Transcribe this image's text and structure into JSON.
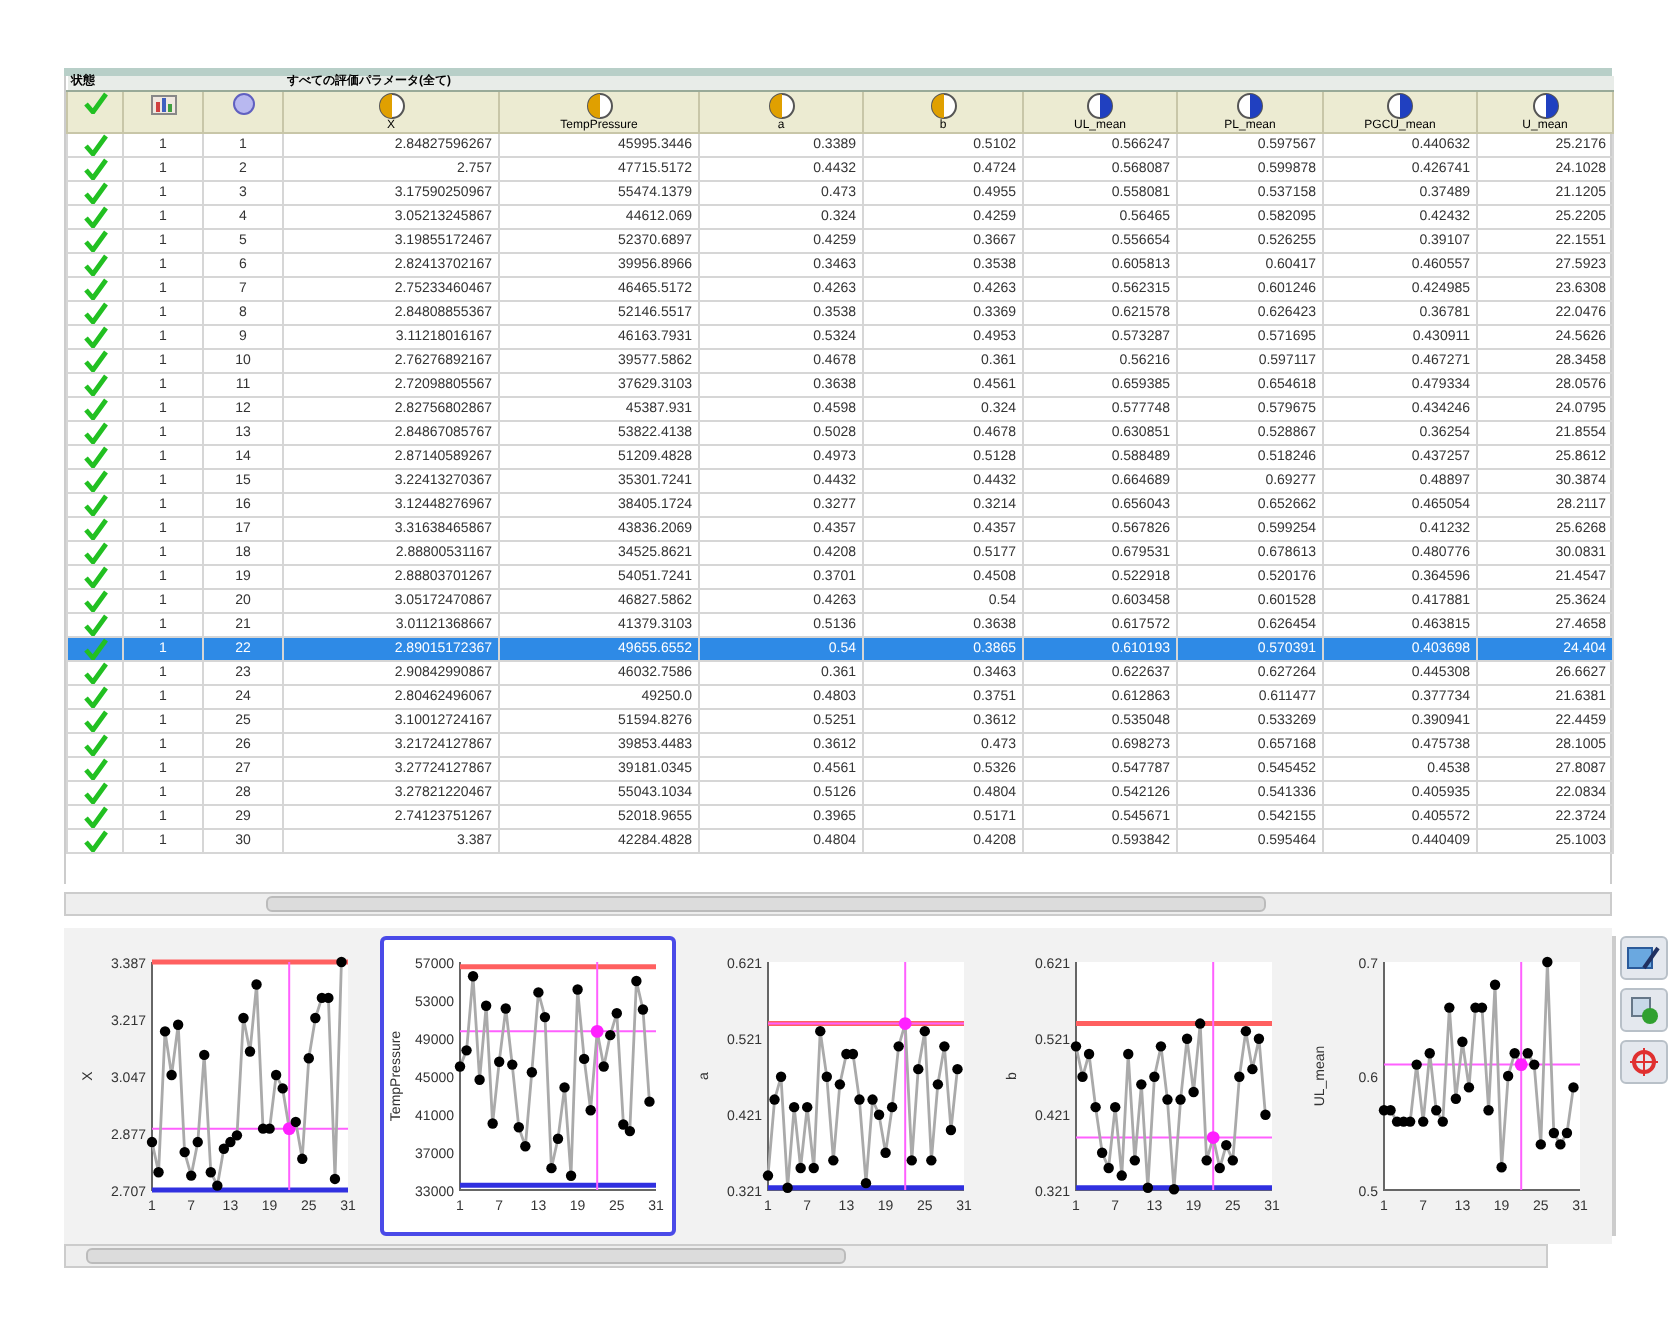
{
  "table": {
    "group_headers": [
      {
        "label": "状態"
      },
      {
        "label": "すべての評価パラメータ(全て)"
      }
    ],
    "columns": [
      {
        "kind": "status"
      },
      {
        "kind": "id"
      },
      {
        "kind": "input",
        "label": "X"
      },
      {
        "kind": "input",
        "label": "TempPressure"
      },
      {
        "kind": "input",
        "label": "a"
      },
      {
        "kind": "input",
        "label": "b"
      },
      {
        "kind": "output",
        "label": "UL_mean"
      },
      {
        "kind": "output",
        "label": "PL_mean"
      },
      {
        "kind": "output",
        "label": "PGCU_mean"
      },
      {
        "kind": "output",
        "label": "U_mean"
      }
    ],
    "rows": [
      {
        "checked": true,
        "selected": false,
        "cells": [
          "1",
          "1",
          "2.84827596267",
          "45995.3446",
          "0.3389",
          "0.5102",
          "0.566247",
          "0.597567",
          "0.440632",
          "25.2176"
        ]
      },
      {
        "checked": true,
        "selected": false,
        "cells": [
          "1",
          "2",
          "2.757",
          "47715.5172",
          "0.4432",
          "0.4724",
          "0.568087",
          "0.599878",
          "0.426741",
          "24.1028"
        ]
      },
      {
        "checked": true,
        "selected": false,
        "cells": [
          "1",
          "3",
          "3.17590250967",
          "55474.1379",
          "0.473",
          "0.4955",
          "0.558081",
          "0.537158",
          "0.37489",
          "21.1205"
        ]
      },
      {
        "checked": true,
        "selected": false,
        "cells": [
          "1",
          "4",
          "3.05213245867",
          "44612.069",
          "0.324",
          "0.4259",
          "0.56465",
          "0.582095",
          "0.42432",
          "25.2205"
        ]
      },
      {
        "checked": true,
        "selected": false,
        "cells": [
          "1",
          "5",
          "3.19855172467",
          "52370.6897",
          "0.4259",
          "0.3667",
          "0.556654",
          "0.526255",
          "0.39107",
          "22.1551"
        ]
      },
      {
        "checked": true,
        "selected": false,
        "cells": [
          "1",
          "6",
          "2.82413702167",
          "39956.8966",
          "0.3463",
          "0.3538",
          "0.605813",
          "0.60417",
          "0.460557",
          "27.5923"
        ]
      },
      {
        "checked": true,
        "selected": false,
        "cells": [
          "1",
          "7",
          "2.75233460467",
          "46465.5172",
          "0.4263",
          "0.4263",
          "0.562315",
          "0.601246",
          "0.424985",
          "23.6308"
        ]
      },
      {
        "checked": true,
        "selected": false,
        "cells": [
          "1",
          "8",
          "2.84808855367",
          "52146.5517",
          "0.3538",
          "0.3369",
          "0.621578",
          "0.626423",
          "0.36781",
          "22.0476"
        ]
      },
      {
        "checked": true,
        "selected": false,
        "cells": [
          "1",
          "9",
          "3.11218016167",
          "46163.7931",
          "0.5324",
          "0.4953",
          "0.573287",
          "0.571695",
          "0.430911",
          "24.5626"
        ]
      },
      {
        "checked": true,
        "selected": false,
        "cells": [
          "1",
          "10",
          "2.76276892167",
          "39577.5862",
          "0.4678",
          "0.361",
          "0.56216",
          "0.597117",
          "0.467271",
          "28.3458"
        ]
      },
      {
        "checked": true,
        "selected": false,
        "cells": [
          "1",
          "11",
          "2.72098805567",
          "37629.3103",
          "0.3638",
          "0.4561",
          "0.659385",
          "0.654618",
          "0.479334",
          "28.0576"
        ]
      },
      {
        "checked": true,
        "selected": false,
        "cells": [
          "1",
          "12",
          "2.82756802867",
          "45387.931",
          "0.4598",
          "0.324",
          "0.577748",
          "0.579675",
          "0.434246",
          "24.0795"
        ]
      },
      {
        "checked": true,
        "selected": false,
        "cells": [
          "1",
          "13",
          "2.84867085767",
          "53822.4138",
          "0.5028",
          "0.4678",
          "0.630851",
          "0.528867",
          "0.36254",
          "21.8554"
        ]
      },
      {
        "checked": true,
        "selected": false,
        "cells": [
          "1",
          "14",
          "2.87140589267",
          "51209.4828",
          "0.4973",
          "0.5128",
          "0.588489",
          "0.518246",
          "0.437257",
          "25.8612"
        ]
      },
      {
        "checked": true,
        "selected": false,
        "cells": [
          "1",
          "15",
          "3.22413270367",
          "35301.7241",
          "0.4432",
          "0.4432",
          "0.664689",
          "0.69277",
          "0.48897",
          "30.3874"
        ]
      },
      {
        "checked": true,
        "selected": false,
        "cells": [
          "1",
          "16",
          "3.12448276967",
          "38405.1724",
          "0.3277",
          "0.3214",
          "0.656043",
          "0.652662",
          "0.465054",
          "28.2117"
        ]
      },
      {
        "checked": true,
        "selected": false,
        "cells": [
          "1",
          "17",
          "3.31638465867",
          "43836.2069",
          "0.4357",
          "0.4357",
          "0.567826",
          "0.599254",
          "0.41232",
          "25.6268"
        ]
      },
      {
        "checked": true,
        "selected": false,
        "cells": [
          "1",
          "18",
          "2.88800531167",
          "34525.8621",
          "0.4208",
          "0.5177",
          "0.679531",
          "0.678613",
          "0.480776",
          "30.0831"
        ]
      },
      {
        "checked": true,
        "selected": false,
        "cells": [
          "1",
          "19",
          "2.88803701267",
          "54051.7241",
          "0.3701",
          "0.4508",
          "0.522918",
          "0.520176",
          "0.364596",
          "21.4547"
        ]
      },
      {
        "checked": true,
        "selected": false,
        "cells": [
          "1",
          "20",
          "3.05172470867",
          "46827.5862",
          "0.4263",
          "0.54",
          "0.603458",
          "0.601528",
          "0.417881",
          "25.3624"
        ]
      },
      {
        "checked": true,
        "selected": false,
        "cells": [
          "1",
          "21",
          "3.01121368667",
          "41379.3103",
          "0.5136",
          "0.3638",
          "0.617572",
          "0.626454",
          "0.463815",
          "27.4658"
        ]
      },
      {
        "checked": true,
        "selected": true,
        "cells": [
          "1",
          "22",
          "2.89015172367",
          "49655.6552",
          "0.54",
          "0.3865",
          "0.610193",
          "0.570391",
          "0.403698",
          "24.404"
        ]
      },
      {
        "checked": true,
        "selected": false,
        "cells": [
          "1",
          "23",
          "2.90842990867",
          "46032.7586",
          "0.361",
          "0.3463",
          "0.622637",
          "0.627264",
          "0.445308",
          "26.6627"
        ]
      },
      {
        "checked": true,
        "selected": false,
        "cells": [
          "1",
          "24",
          "2.80462496067",
          "49250.0",
          "0.4803",
          "0.3751",
          "0.612863",
          "0.611477",
          "0.377734",
          "21.6381"
        ]
      },
      {
        "checked": true,
        "selected": false,
        "cells": [
          "1",
          "25",
          "3.10012724167",
          "51594.8276",
          "0.5251",
          "0.3612",
          "0.535048",
          "0.533269",
          "0.390941",
          "22.4459"
        ]
      },
      {
        "checked": true,
        "selected": false,
        "cells": [
          "1",
          "26",
          "3.21724127867",
          "39853.4483",
          "0.3612",
          "0.473",
          "0.698273",
          "0.657168",
          "0.475738",
          "28.1005"
        ]
      },
      {
        "checked": true,
        "selected": false,
        "cells": [
          "1",
          "27",
          "3.27724127867",
          "39181.0345",
          "0.4561",
          "0.5326",
          "0.547787",
          "0.545452",
          "0.4538",
          "27.8087"
        ]
      },
      {
        "checked": true,
        "selected": false,
        "cells": [
          "1",
          "28",
          "3.27821220467",
          "55043.1034",
          "0.5126",
          "0.4804",
          "0.542126",
          "0.541336",
          "0.405935",
          "22.0834"
        ]
      },
      {
        "checked": true,
        "selected": false,
        "cells": [
          "1",
          "29",
          "2.74123751267",
          "52018.9655",
          "0.3965",
          "0.5171",
          "0.545671",
          "0.542155",
          "0.405572",
          "22.3724"
        ]
      },
      {
        "checked": true,
        "selected": false,
        "cells": [
          "1",
          "30",
          "3.387",
          "42284.4828",
          "0.4804",
          "0.4208",
          "0.593842",
          "0.595464",
          "0.440409",
          "25.1003"
        ]
      }
    ]
  },
  "charts": [
    {
      "selected": false,
      "chart_data": {
        "type": "line",
        "x": [
          1,
          2,
          3,
          4,
          5,
          6,
          7,
          8,
          9,
          10,
          11,
          12,
          13,
          14,
          15,
          16,
          17,
          18,
          19,
          20,
          21,
          22,
          23,
          24,
          25,
          26,
          27,
          28,
          29,
          30
        ],
        "xlim": [
          1,
          31
        ],
        "ylim": [
          2.707,
          3.387
        ],
        "xticks": [
          1,
          7,
          13,
          19,
          25,
          31
        ],
        "yticks": [
          2.707,
          2.877,
          3.047,
          3.217,
          3.387
        ],
        "series": [
          {
            "name": "X",
            "color": "#000000",
            "marker": "o",
            "values": [
              2.85,
              2.76,
              3.18,
              3.05,
              3.2,
              2.82,
              2.75,
              2.85,
              3.11,
              2.76,
              2.72,
              2.83,
              2.85,
              2.87,
              3.22,
              3.12,
              3.32,
              2.89,
              2.89,
              3.05,
              3.01,
              2.89,
              2.91,
              2.8,
              3.1,
              3.22,
              3.28,
              3.28,
              2.74,
              3.387
            ]
          }
        ],
        "ref_lines": [
          {
            "axis": "y",
            "value": 3.387,
            "color": "#ff6060"
          },
          {
            "axis": "y",
            "value": 2.707,
            "color": "#3030e0"
          },
          {
            "axis": "x",
            "value": 22,
            "color": "#ff60ff"
          },
          {
            "axis": "y",
            "value": 2.89,
            "color": "#ff60ff"
          }
        ]
      }
    },
    {
      "selected": true,
      "chart_data": {
        "type": "line",
        "x": [
          1,
          2,
          3,
          4,
          5,
          6,
          7,
          8,
          9,
          10,
          11,
          12,
          13,
          14,
          15,
          16,
          17,
          18,
          19,
          20,
          21,
          22,
          23,
          24,
          25,
          26,
          27,
          28,
          29,
          30
        ],
        "xlim": [
          1,
          31
        ],
        "ylim": [
          33000,
          57000
        ],
        "xticks": [
          1,
          7,
          13,
          19,
          25,
          31
        ],
        "yticks": [
          33000,
          37000,
          41000,
          45000,
          49000,
          53000,
          57000
        ],
        "series": [
          {
            "name": "TempPressure",
            "color": "#000000",
            "marker": "o",
            "values": [
              46000,
              47700,
              55500,
              44600,
              52400,
              40000,
              46500,
              52100,
              46200,
              39600,
              37600,
              45400,
              53800,
              51200,
              35300,
              38400,
              43800,
              34500,
              54100,
              46800,
              41400,
              49700,
              46000,
              49300,
              51600,
              39900,
              39200,
              55000,
              52000,
              42300
            ]
          }
        ],
        "ref_lines": [
          {
            "axis": "y",
            "value": 56500,
            "color": "#ff6060"
          },
          {
            "axis": "y",
            "value": 33500,
            "color": "#3030e0"
          },
          {
            "axis": "x",
            "value": 22,
            "color": "#ff60ff"
          },
          {
            "axis": "y",
            "value": 49700,
            "color": "#ff60ff"
          }
        ]
      }
    },
    {
      "selected": false,
      "chart_data": {
        "type": "line",
        "x": [
          1,
          2,
          3,
          4,
          5,
          6,
          7,
          8,
          9,
          10,
          11,
          12,
          13,
          14,
          15,
          16,
          17,
          18,
          19,
          20,
          21,
          22,
          23,
          24,
          25,
          26,
          27,
          28,
          29,
          30
        ],
        "xlim": [
          1,
          31
        ],
        "ylim": [
          0.321,
          0.621
        ],
        "xticks": [
          1,
          7,
          13,
          19,
          25,
          31
        ],
        "yticks": [
          0.321,
          0.421,
          0.521,
          0.621
        ],
        "series": [
          {
            "name": "a",
            "color": "#000000",
            "marker": "o",
            "values": [
              0.34,
              0.44,
              0.47,
              0.324,
              0.43,
              0.35,
              0.43,
              0.35,
              0.53,
              0.47,
              0.36,
              0.46,
              0.5,
              0.5,
              0.44,
              0.33,
              0.44,
              0.42,
              0.37,
              0.43,
              0.51,
              0.54,
              0.36,
              0.48,
              0.53,
              0.36,
              0.46,
              0.51,
              0.4,
              0.48
            ]
          }
        ],
        "ref_lines": [
          {
            "axis": "y",
            "value": 0.54,
            "color": "#ff6060"
          },
          {
            "axis": "y",
            "value": 0.324,
            "color": "#3030e0"
          },
          {
            "axis": "x",
            "value": 22,
            "color": "#ff60ff"
          },
          {
            "axis": "y",
            "value": 0.54,
            "color": "#ff60ff"
          }
        ]
      }
    },
    {
      "selected": false,
      "chart_data": {
        "type": "line",
        "x": [
          1,
          2,
          3,
          4,
          5,
          6,
          7,
          8,
          9,
          10,
          11,
          12,
          13,
          14,
          15,
          16,
          17,
          18,
          19,
          20,
          21,
          22,
          23,
          24,
          25,
          26,
          27,
          28,
          29,
          30
        ],
        "xlim": [
          1,
          31
        ],
        "ylim": [
          0.321,
          0.621
        ],
        "xticks": [
          1,
          7,
          13,
          19,
          25,
          31
        ],
        "yticks": [
          0.321,
          0.421,
          0.521,
          0.621
        ],
        "series": [
          {
            "name": "b",
            "color": "#000000",
            "marker": "o",
            "values": [
              0.51,
              0.47,
              0.5,
              0.43,
              0.37,
              0.35,
              0.43,
              0.34,
              0.5,
              0.36,
              0.46,
              0.324,
              0.47,
              0.51,
              0.44,
              0.322,
              0.44,
              0.52,
              0.45,
              0.54,
              0.36,
              0.39,
              0.35,
              0.38,
              0.36,
              0.47,
              0.53,
              0.48,
              0.52,
              0.42
            ]
          }
        ],
        "ref_lines": [
          {
            "axis": "y",
            "value": 0.54,
            "color": "#ff6060"
          },
          {
            "axis": "y",
            "value": 0.324,
            "color": "#3030e0"
          },
          {
            "axis": "x",
            "value": 22,
            "color": "#ff60ff"
          },
          {
            "axis": "y",
            "value": 0.39,
            "color": "#ff60ff"
          }
        ]
      }
    },
    {
      "selected": false,
      "chart_data": {
        "type": "line",
        "x": [
          1,
          2,
          3,
          4,
          5,
          6,
          7,
          8,
          9,
          10,
          11,
          12,
          13,
          14,
          15,
          16,
          17,
          18,
          19,
          20,
          21,
          22,
          23,
          24,
          25,
          26,
          27,
          28,
          29,
          30
        ],
        "xlim": [
          1,
          31
        ],
        "ylim": [
          0.5,
          0.7
        ],
        "xticks": [
          1,
          7,
          13,
          19,
          25,
          31
        ],
        "yticks": [
          0.5,
          0.6,
          0.7
        ],
        "series": [
          {
            "name": "UL_mean",
            "color": "#000000",
            "marker": "o",
            "values": [
              0.57,
              0.57,
              0.56,
              0.56,
              0.56,
              0.61,
              0.56,
              0.62,
              0.57,
              0.56,
              0.66,
              0.58,
              0.63,
              0.59,
              0.66,
              0.66,
              0.57,
              0.68,
              0.52,
              0.6,
              0.62,
              0.61,
              0.62,
              0.61,
              0.54,
              0.7,
              0.55,
              0.54,
              0.55,
              0.59
            ]
          }
        ],
        "ref_lines": [
          {
            "axis": "x",
            "value": 22,
            "color": "#ff60ff"
          },
          {
            "axis": "y",
            "value": 0.61,
            "color": "#ff60ff"
          }
        ]
      }
    }
  ],
  "tools": [
    {
      "kind": "edit"
    },
    {
      "kind": "add"
    },
    {
      "kind": "target"
    }
  ]
}
